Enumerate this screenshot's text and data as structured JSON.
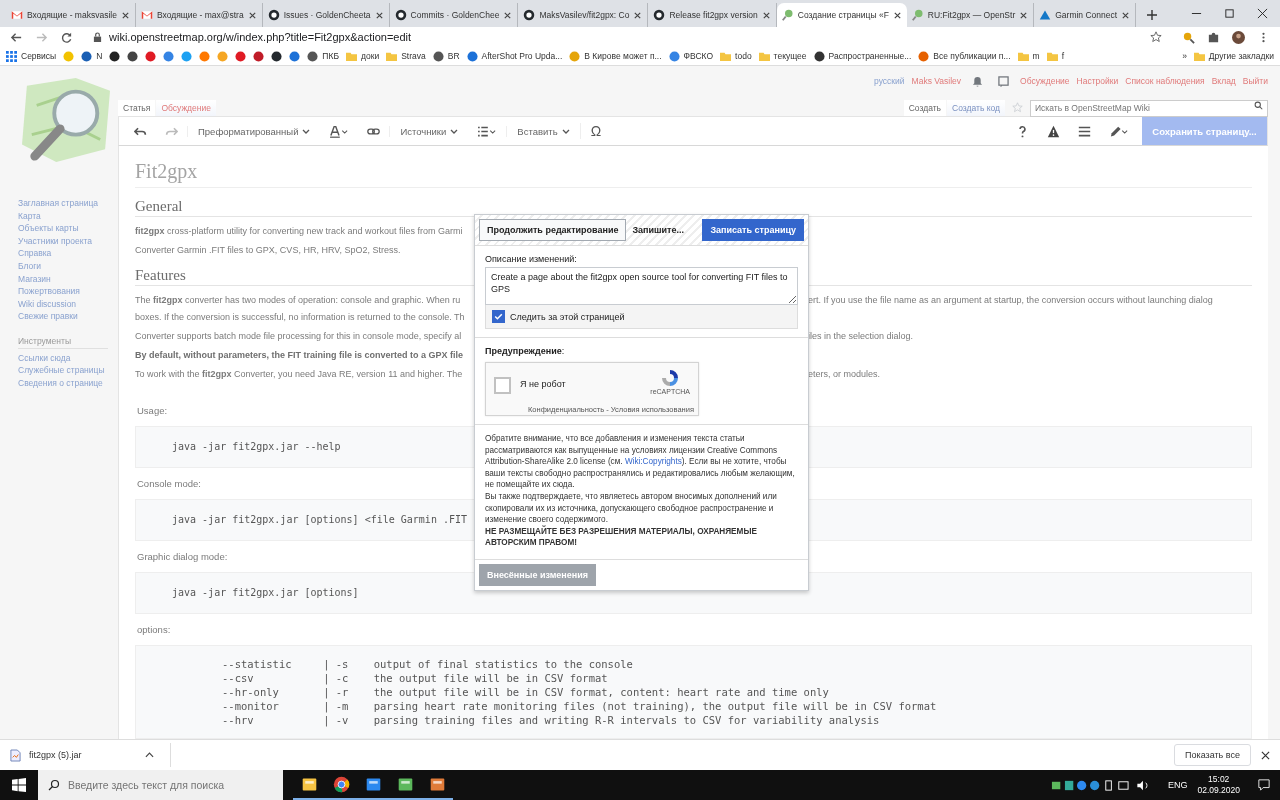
{
  "browser": {
    "tabs": [
      {
        "title": "Входящие - maksvasile",
        "kind": "gmail",
        "selected": false
      },
      {
        "title": "Входящие - max@stra",
        "kind": "gmail",
        "selected": false
      },
      {
        "title": "Issues · GoldenCheeta",
        "kind": "github",
        "selected": false
      },
      {
        "title": "Commits · GoldenChee",
        "kind": "github",
        "selected": false
      },
      {
        "title": "MaksVasilev/fit2gpx: Co",
        "kind": "github",
        "selected": false
      },
      {
        "title": "Release fit2gpx version",
        "kind": "github",
        "selected": false
      },
      {
        "title": "Создание страницы «F",
        "kind": "wiki",
        "selected": true
      },
      {
        "title": "RU:Fit2gpx — OpenStr",
        "kind": "wiki",
        "selected": false
      },
      {
        "title": "Garmin Connect",
        "kind": "garmin",
        "selected": false
      }
    ],
    "url": "wiki.openstreetmap.org/w/index.php?title=Fit2gpx&action=edit",
    "bookmarks": [
      {
        "label": "Сервисы",
        "kind": "apps"
      },
      {
        "kind": "site",
        "color": "#f2c200"
      },
      {
        "label": "N",
        "kind": "site",
        "color": "#1a5fb4"
      },
      {
        "kind": "site",
        "color": "#222222"
      },
      {
        "kind": "site",
        "color": "#444444"
      },
      {
        "kind": "site",
        "color": "#e01b24"
      },
      {
        "kind": "site",
        "color": "#3584e4"
      },
      {
        "kind": "site",
        "color": "#1da1f2"
      },
      {
        "kind": "site",
        "color": "#ff7800"
      },
      {
        "kind": "site",
        "color": "#f5a623"
      },
      {
        "kind": "site",
        "color": "#e01b24"
      },
      {
        "kind": "site",
        "color": "#c01c28"
      },
      {
        "kind": "site",
        "color": "#24292e"
      },
      {
        "kind": "site",
        "color": "#1c71d8"
      },
      {
        "label": "ПКБ",
        "kind": "site",
        "color": "#555555"
      },
      {
        "label": "доки",
        "kind": "folder"
      },
      {
        "label": "Strava",
        "kind": "folder"
      },
      {
        "label": "BR",
        "kind": "site",
        "color": "#555555"
      },
      {
        "label": "AfterShot Pro Upda...",
        "kind": "site",
        "color": "#1c71d8"
      },
      {
        "label": "В Кирове может п...",
        "kind": "site",
        "color": "#e5a50a"
      },
      {
        "label": "ФВСКО",
        "kind": "site",
        "color": "#3584e4"
      },
      {
        "label": "todo",
        "kind": "folder"
      },
      {
        "label": "текущее",
        "kind": "folder"
      },
      {
        "label": "Распространенные...",
        "kind": "site",
        "color": "#333333"
      },
      {
        "label": "Все публикации п...",
        "kind": "site",
        "color": "#e66100"
      },
      {
        "label": "m",
        "kind": "folder"
      },
      {
        "label": "f",
        "kind": "folder"
      },
      {
        "label": "»",
        "kind": "more"
      },
      {
        "label": "Другие закладки",
        "kind": "folder"
      }
    ]
  },
  "wiki": {
    "personal": [
      {
        "label": "русский",
        "kind": "lang"
      },
      {
        "label": "Maks Vasilev",
        "kind": "user"
      },
      {
        "kind": "bell"
      },
      {
        "kind": "notice"
      },
      {
        "label": "Обсуждение",
        "kind": "link"
      },
      {
        "label": "Настройки",
        "kind": "link"
      },
      {
        "label": "Список наблюдения",
        "kind": "link"
      },
      {
        "label": "Вклад",
        "kind": "link"
      },
      {
        "label": "Выйти",
        "kind": "link"
      }
    ],
    "tabs": [
      {
        "label": "Статья",
        "selected": true
      },
      {
        "label": "Обсуждение",
        "selected": false
      }
    ],
    "views": [
      {
        "label": "Создать",
        "selected": true
      },
      {
        "label": "Создать код",
        "selected": false
      }
    ],
    "search": {
      "placeholder": "Искать в OpenStreetMap Wiki"
    },
    "toolbar": [
      {
        "kind": "undo"
      },
      {
        "kind": "redo"
      },
      {
        "kind": "menu",
        "label": "Преформатированный"
      },
      {
        "kind": "style"
      },
      {
        "kind": "link"
      },
      {
        "kind": "menu",
        "label": "Источники"
      },
      {
        "kind": "list"
      },
      {
        "kind": "menu",
        "label": "Вставить"
      },
      {
        "kind": "text",
        "label": "Ω"
      }
    ],
    "toolbar_right": [
      {
        "kind": "help"
      },
      {
        "kind": "warning"
      },
      {
        "kind": "menu"
      },
      {
        "kind": "pencil"
      }
    ],
    "save_button": "Сохранить страницу...",
    "sidebar": {
      "nav": [
        "Заглавная страница",
        "Карта",
        "Объекты карты",
        "Участники проекта",
        "Справка",
        "Блоги",
        "Магазин",
        "Пожертвования",
        "Wiki discussion",
        "Свежие правки"
      ],
      "tools_heading": "Инструменты",
      "tools": [
        "Ссылки сюда",
        "Служебные страницы",
        "Сведения о странице"
      ]
    },
    "content": [
      {
        "kind": "title",
        "text": "Fit2gpx"
      },
      {
        "kind": "heading",
        "text": "General"
      },
      {
        "kind": "p",
        "lines": [
          {
            "left": "**fit2gpx** cross-platform utility for converting new track and workout files from Garmi"
          }
        ]
      },
      {
        "kind": "p",
        "lines": [
          {
            "left": "Converter Garmin .FIT files to GPX, CVS, HR, HRV, SpO2, Stress."
          }
        ]
      },
      {
        "kind": "heading",
        "text": "Features"
      },
      {
        "kind": "p",
        "lines": [
          {
            "left": "The **fit2gpx** converter has two modes of operation: console and graphic. When ru",
            "right": "ert. If you use the file name as an argument at startup, the conversion occurs without launching dialog"
          },
          {
            "left": "boxes. If the conversion is successful, no information is returned to the console. Th"
          }
        ]
      },
      {
        "kind": "p",
        "lines": [
          {
            "left": "Converter supports batch mode file processing for this in console mode, specify al",
            "right": "iles in the selection dialog."
          }
        ]
      },
      {
        "kind": "p",
        "bold": true,
        "lines": [
          {
            "left": "By default, without parameters, the FIT training file is converted to a GPX file"
          }
        ]
      },
      {
        "kind": "p",
        "lines": [
          {
            "left": "To work with the **fit2gpx** Converter, you need Java RE, version 11 and higher. The",
            "right": "eters, or modules."
          }
        ]
      },
      {
        "kind": "label",
        "text": "Usage:"
      },
      {
        "kind": "code",
        "lines": [
          "java -jar fit2gpx.jar --help"
        ]
      },
      {
        "kind": "label",
        "text": "Console mode:"
      },
      {
        "kind": "code",
        "lines": [
          "java -jar fit2gpx.jar [options] <file Garmin .FIT"
        ]
      },
      {
        "kind": "label",
        "text": "Graphic dialog mode:"
      },
      {
        "kind": "code",
        "lines": [
          "java -jar fit2gpx.jar [options]"
        ]
      },
      {
        "kind": "label",
        "text": "options:"
      },
      {
        "kind": "options",
        "lines": [
          "--statistic     | -s    output of final statistics to the console",
          "--csv           | -c    the output file will be in CSV format",
          "--hr-only       | -r    the output file will be in CSV format, content: heart rate and time only",
          "--monitor       | -m    parsing heart rate monitoring files (not training), the output file will be in CSV format",
          "--hrv           | -v    parsing training files and writing R-R intervals to CSV for variability analysis"
        ]
      }
    ]
  },
  "dialog": {
    "back_button": "Продолжить редактирование",
    "step_label": "Запишите...",
    "save_button": "Записать страницу",
    "summary_label": "Описание изменений:",
    "summary": "Create a page about the fit2gpx open source tool for converting FIT files to GPS",
    "watch": {
      "label": "Следить за этой страницей",
      "checked": true
    },
    "warning_label": "**Предупреждение**:",
    "captcha": {
      "label": "Я не робот",
      "checked": false,
      "brand": "reCAPTCHA",
      "terms": "Конфиденциальность - Условия использования"
    },
    "license_before": "Обратите внимание, что все добавления и изменения текста статьи рассматриваются как выпущенные на условиях лицензии Creative Commons Attribution-ShareAlike 2.0 license (см. ",
    "license_link": "Wiki:Copyrights",
    "license_after": "). Если вы не хотите, чтобы ваши тексты свободно распространялись и редактировались любым желающим, не помещайте их сюда.",
    "license_2": "Вы также подтверждаете, что являетесь автором вносимых дополнений или скопировали их из источника, допускающего свободное распространение и изменение своего содержимого.",
    "license_3": "НЕ РАЗМЕЩАЙТЕ БЕЗ РАЗРЕШЕНИЯ МАТЕРИАЛЫ, ОХРАНЯЕМЫЕ АВТОРСКИМ ПРАВОМ!",
    "changes_button": {
      "label": "Внесённые изменения",
      "disabled": true
    }
  },
  "downloads": {
    "file": "fit2gpx (5).jar",
    "show_all": "Показать все"
  },
  "taskbar": {
    "search_placeholder": "Введите здесь текст для поиска",
    "apps": [
      {
        "kind": "explorer",
        "active": true
      },
      {
        "kind": "chrome",
        "active": true
      },
      {
        "kind": "app",
        "active": true
      },
      {
        "kind": "notepad",
        "active": true
      },
      {
        "kind": "photo",
        "active": true
      }
    ],
    "lang": "ENG",
    "time": "15:02",
    "date": "02.09.2020"
  }
}
